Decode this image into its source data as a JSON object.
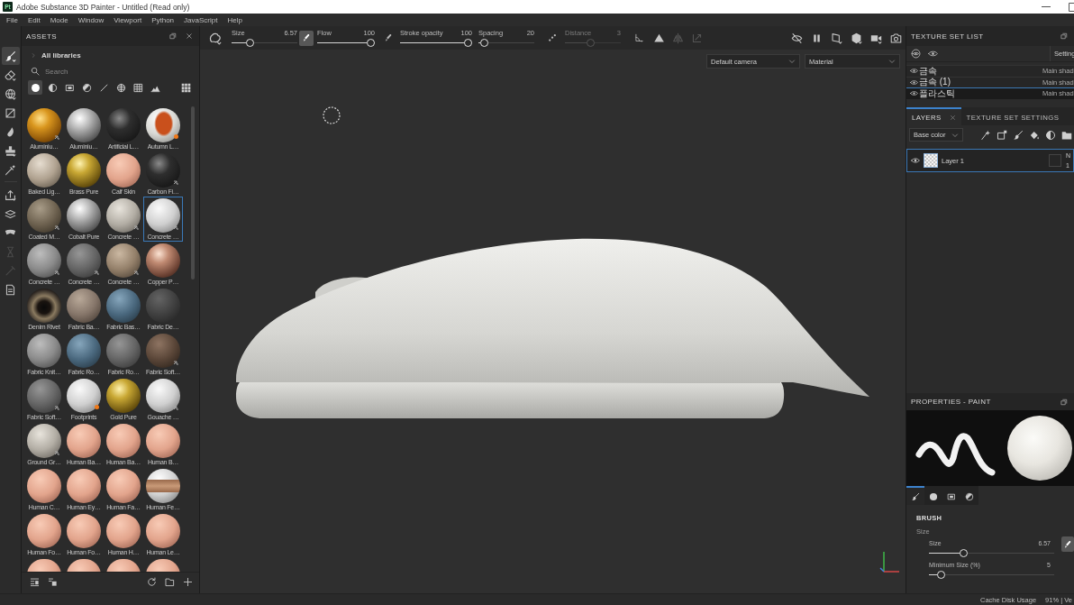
{
  "window": {
    "logo": "Pt",
    "title": "Adobe Substance 3D Painter - Untitled (Read only)"
  },
  "menu": [
    "File",
    "Edit",
    "Mode",
    "Window",
    "Viewport",
    "Python",
    "JavaScript",
    "Help"
  ],
  "tools": [
    {
      "selected": true,
      "disabled": false
    },
    {
      "selected": false,
      "disabled": false
    },
    {
      "selected": false,
      "disabled": false
    },
    {
      "selected": false,
      "disabled": false
    },
    {
      "selected": false,
      "disabled": false
    },
    {
      "selected": false,
      "disabled": false
    },
    {
      "selected": false,
      "disabled": false
    },
    {
      "selected": false,
      "disabled": false
    },
    {
      "selected": false,
      "disabled": false
    },
    {
      "selected": false,
      "disabled": false
    },
    {
      "selected": false,
      "disabled": true
    },
    {
      "selected": false,
      "disabled": true
    },
    {
      "selected": false,
      "disabled": false
    }
  ],
  "assets": {
    "title": "ASSETS",
    "library": "All libraries",
    "search": {
      "placeholder": "Search"
    },
    "filters": [
      {
        "selected": true
      },
      {
        "selected": false
      },
      {
        "selected": false
      },
      {
        "selected": false
      },
      {
        "selected": false
      },
      {
        "selected": false
      },
      {
        "selected": false
      },
      {
        "selected": false
      }
    ],
    "items": [
      {
        "name": "Aluminiu…",
        "kind": "gold",
        "tag": true,
        "dot": false,
        "selected": false
      },
      {
        "name": "Aluminiu…",
        "kind": "chrome",
        "tag": false,
        "dot": false,
        "selected": false
      },
      {
        "name": "Artificial L…",
        "kind": "black",
        "tag": false,
        "dot": false,
        "selected": false
      },
      {
        "name": "Autumn L…",
        "kind": "leaf",
        "tag": false,
        "dot": true,
        "selected": false
      },
      {
        "name": "Baked Lig…",
        "kind": "beige",
        "tag": false,
        "dot": false,
        "selected": false
      },
      {
        "name": "Brass Pure",
        "kind": "brass",
        "tag": false,
        "dot": false,
        "selected": false
      },
      {
        "name": "Calf Skin",
        "kind": "skin",
        "tag": false,
        "dot": false,
        "selected": false
      },
      {
        "name": "Carbon Fi…",
        "kind": "black",
        "tag": true,
        "dot": false,
        "selected": false
      },
      {
        "name": "Coated M…",
        "kind": "olive",
        "tag": true,
        "dot": false,
        "selected": false
      },
      {
        "name": "Cobalt Pure",
        "kind": "chrome",
        "tag": false,
        "dot": false,
        "selected": false
      },
      {
        "name": "Concrete …",
        "kind": "stone",
        "tag": true,
        "dot": false,
        "selected": false
      },
      {
        "name": "Concrete …",
        "kind": "white",
        "tag": true,
        "dot": false,
        "selected": true
      },
      {
        "name": "Concrete …",
        "kind": "grey",
        "tag": true,
        "dot": false,
        "selected": false
      },
      {
        "name": "Concrete …",
        "kind": "darkgrey",
        "tag": true,
        "dot": false,
        "selected": false
      },
      {
        "name": "Concrete …",
        "kind": "sand",
        "tag": true,
        "dot": false,
        "selected": false
      },
      {
        "name": "Copper P…",
        "kind": "copper",
        "tag": false,
        "dot": false,
        "selected": false
      },
      {
        "name": "Denim Rivet",
        "kind": "rivet",
        "tag": false,
        "dot": false,
        "selected": false
      },
      {
        "name": "Fabric Ba…",
        "kind": "fabric",
        "tag": false,
        "dot": false,
        "selected": false
      },
      {
        "name": "Fabric Bas…",
        "kind": "denim",
        "tag": false,
        "dot": false,
        "selected": false
      },
      {
        "name": "Fabric De…",
        "kind": "charcoal",
        "tag": false,
        "dot": false,
        "selected": false
      },
      {
        "name": "Fabric Knit…",
        "kind": "grey",
        "tag": false,
        "dot": false,
        "selected": false
      },
      {
        "name": "Fabric Ro…",
        "kind": "denim",
        "tag": false,
        "dot": false,
        "selected": false
      },
      {
        "name": "Fabric Ro…",
        "kind": "darkgrey",
        "tag": false,
        "dot": false,
        "selected": false
      },
      {
        "name": "Fabric Soft…",
        "kind": "brown",
        "tag": true,
        "dot": false,
        "selected": false
      },
      {
        "name": "Fabric Soft…",
        "kind": "darkgrey",
        "tag": true,
        "dot": false,
        "selected": false
      },
      {
        "name": "Footprints",
        "kind": "white",
        "tag": false,
        "dot": true,
        "selected": false
      },
      {
        "name": "Gold Pure",
        "kind": "brass",
        "tag": false,
        "dot": false,
        "selected": false
      },
      {
        "name": "Gouache …",
        "kind": "white",
        "tag": true,
        "dot": false,
        "selected": false
      },
      {
        "name": "Ground Gr…",
        "kind": "stone",
        "tag": true,
        "dot": false,
        "selected": false
      },
      {
        "name": "Human Ba…",
        "kind": "skin",
        "tag": false,
        "dot": false,
        "selected": false
      },
      {
        "name": "Human Ba…",
        "kind": "skin",
        "tag": false,
        "dot": false,
        "selected": false
      },
      {
        "name": "Human B…",
        "kind": "skin",
        "tag": false,
        "dot": false,
        "selected": false
      },
      {
        "name": "Human C…",
        "kind": "skin",
        "tag": false,
        "dot": false,
        "selected": false
      },
      {
        "name": "Human Ey…",
        "kind": "skin",
        "tag": false,
        "dot": false,
        "selected": false
      },
      {
        "name": "Human Fa…",
        "kind": "skin",
        "tag": false,
        "dot": false,
        "selected": false
      },
      {
        "name": "Human Fe…",
        "kind": "pattern",
        "tag": false,
        "dot": false,
        "selected": false
      },
      {
        "name": "Human Fo…",
        "kind": "skin",
        "tag": false,
        "dot": false,
        "selected": false
      },
      {
        "name": "Human Fo…",
        "kind": "skin",
        "tag": false,
        "dot": false,
        "selected": false
      },
      {
        "name": "Human H…",
        "kind": "skin",
        "tag": false,
        "dot": false,
        "selected": false
      },
      {
        "name": "Human Le…",
        "kind": "skin",
        "tag": false,
        "dot": false,
        "selected": false
      },
      {
        "kind": "skin",
        "tag": false,
        "dot": false,
        "selected": false
      },
      {
        "kind": "skin",
        "tag": false,
        "dot": false,
        "selected": false
      },
      {
        "kind": "skin",
        "tag": false,
        "dot": false,
        "selected": false
      },
      {
        "kind": "skin",
        "tag": false,
        "dot": false,
        "selected": false
      }
    ]
  },
  "toolbar": {
    "sliders": [
      {
        "label": "Size",
        "value": "6.57",
        "level": 0.25,
        "disabled": false,
        "toggle": true
      },
      {
        "label": "Flow",
        "value": "100",
        "level": 1,
        "disabled": false,
        "toggle": false
      },
      {
        "label": "Stroke opacity",
        "value": "100",
        "level": 1,
        "disabled": false
      },
      {
        "label": "Spacing",
        "value": "20",
        "level": 0.03,
        "disabled": false
      },
      {
        "label": "Distance",
        "value": "3",
        "level": 0.45,
        "disabled": true
      }
    ],
    "symmetry": [
      {
        "disabled": false
      },
      {
        "disabled": true
      },
      {
        "disabled": true
      }
    ]
  },
  "viewport": {
    "camera": "Default camera",
    "shading": "Material"
  },
  "texture_set_list": {
    "title": "TEXTURE SET LIST",
    "settings": "Setting",
    "rows": [
      {
        "name": "금속",
        "shader": "Main shad",
        "visible": true,
        "selected": false
      },
      {
        "name": "금속 (1)",
        "shader": "Main shad",
        "visible": true,
        "selected": false
      },
      {
        "name": "플라스틱",
        "shader": "Main shad",
        "visible": true,
        "selected": true
      }
    ]
  },
  "layers": {
    "tabs": [
      {
        "label": "LAYERS",
        "selected": true,
        "closable": true
      },
      {
        "label": "TEXTURE SET SETTINGS",
        "selected": false,
        "closable": false
      }
    ],
    "channel": "Base color",
    "items": [
      {
        "name": "Layer 1",
        "visible": true,
        "selected": true,
        "blend": "N",
        "opacity": "1"
      }
    ]
  },
  "properties": {
    "title": "PROPERTIES - PAINT",
    "tabs": [
      {
        "selected": true
      },
      {
        "selected": false
      },
      {
        "selected": false
      },
      {
        "selected": false
      }
    ],
    "section": "BRUSH",
    "group": "Size",
    "params": [
      {
        "label": "Size",
        "value": "6.57",
        "level": 0.26,
        "toggle": true
      },
      {
        "label": "Minimum Size (%)",
        "value": "5",
        "level": 0.07
      }
    ]
  },
  "status_bar": {
    "label": "Cache Disk Usage",
    "value": "91% | Ve"
  }
}
